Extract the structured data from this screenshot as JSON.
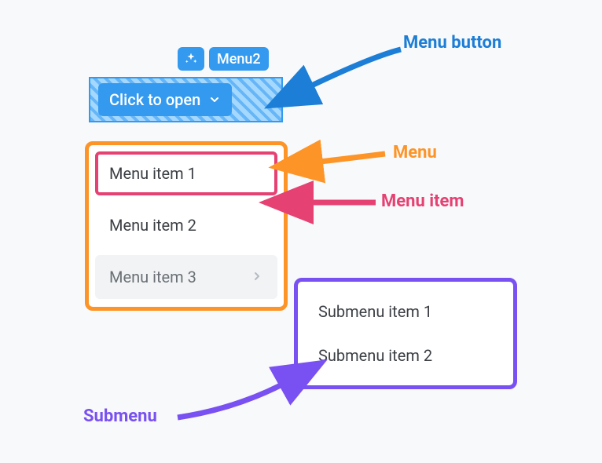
{
  "tags": {
    "badge": "Menu2"
  },
  "menu_button": {
    "label": "Click to open"
  },
  "menu": {
    "items": [
      {
        "label": "Menu item 1"
      },
      {
        "label": "Menu item 2"
      },
      {
        "label": "Menu item 3"
      }
    ]
  },
  "submenu": {
    "items": [
      {
        "label": "Submenu item 1"
      },
      {
        "label": "Submenu item 2"
      }
    ]
  },
  "callouts": {
    "menu_button": "Menu button",
    "menu": "Menu",
    "menu_item": "Menu item",
    "submenu": "Submenu"
  },
  "colors": {
    "blue": "#1c7ed6",
    "button_blue": "#339af0",
    "orange": "#fd9427",
    "pink": "#e64173",
    "purple": "#7950f2"
  }
}
